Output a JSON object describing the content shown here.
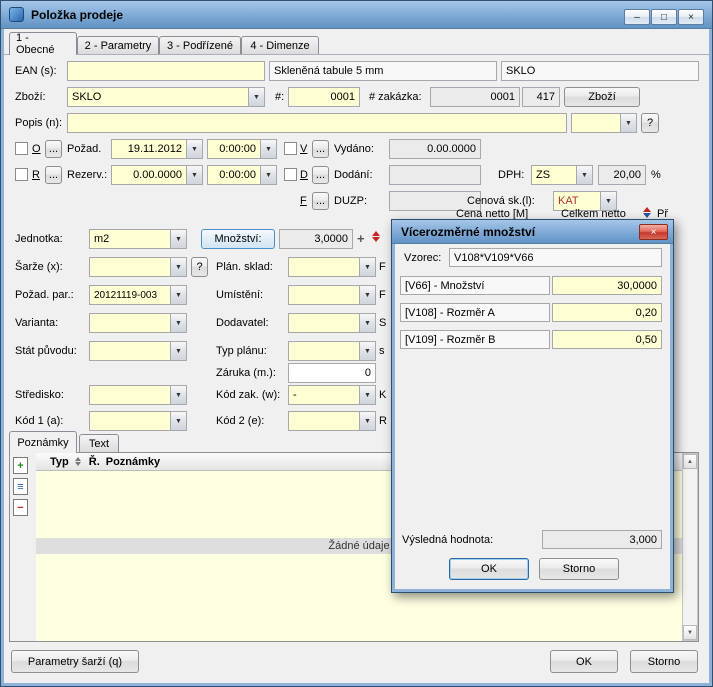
{
  "window": {
    "title": "Položka prodeje",
    "controls": {
      "minimize": "–",
      "maximize": "□",
      "close": "×"
    }
  },
  "tabs": [
    "1 - Obecné",
    "2 - Parametry",
    "3 - Podřízené",
    "4 - Dimenze"
  ],
  "icons": {
    "combo_arrow": "▼",
    "scroll_up": "▲",
    "scroll_down": "▼",
    "plus": "+",
    "add_note": "+",
    "edit_note": "≡",
    "delete_note": "−"
  },
  "form": {
    "ean_label": "EAN (s):",
    "ean_value": "",
    "item_name": "Skleněná tabule 5 mm",
    "item_code": "SKLO",
    "zbozi_label": "Zboží:",
    "zbozi_value": "SKLO",
    "num_label": "#:",
    "num_value": "0001",
    "order_label": "# zakázka:",
    "order_value": "0001",
    "order_id": "417",
    "zbozi_btn": "Zboží",
    "popis_label": "Popis (n):",
    "popis_value": "",
    "popis_combo_value": "",
    "help_btn": "?",
    "dots": "...",
    "o_letter": "O",
    "pozad_label": "Požad.",
    "pozad_date": "19.11.2012",
    "pozad_time": "0:00:00",
    "v_letter": "V",
    "vydano_label": "Vydáno:",
    "vydano_value": "0.00.0000",
    "r_letter": "R",
    "rezerv_label": "Rezerv.:",
    "rezerv_date": "0.00.0000",
    "rezerv_time": "0:00:00",
    "d_letter": "D",
    "dodani_label": "Dodání:",
    "dodani_value": "",
    "dph_label": "DPH:",
    "dph_value": "ZS",
    "dph_rate": "20,00",
    "percent": "%",
    "f_letter": "F",
    "duzp_label": "DUZP:",
    "duzp_value": "",
    "cenova_label": "Cenová sk.(l):",
    "cenova_value": "KAT",
    "cena_netto": "Cena netto [M]",
    "celkem_netto": "Celkem netto",
    "pr_fragment": "Př",
    "jednotka_label": "Jednotka:",
    "jednotka_value": "m2",
    "mnozstvi_btn": "Množství:",
    "mnozstvi_value": "3,0000",
    "sarze_label": "Šarže (x):",
    "sarze_value": "",
    "plan_label": "Plán. sklad:",
    "plan_value": "",
    "pozpar_label": "Požad. par.:",
    "pozpar_value": "20121119-003",
    "umisteni_label": "Umístění:",
    "umisteni_value": "",
    "varianta_label": "Varianta:",
    "varianta_value": "",
    "dodavatel_label": "Dodavatel:",
    "dodavatel_value": "",
    "stat_label": "Stát původu:",
    "stat_value": "",
    "typplanu_label": "Typ plánu:",
    "typplanu_value": "",
    "zaruka_label": "Záruka (m.):",
    "zaruka_value": "0",
    "stredisko_label": "Středisko:",
    "stredisko_value": "",
    "kodzak_label": "Kód zak. (w):",
    "kodzak_value": "-",
    "kod1_label": "Kód 1 (a):",
    "kod1_value": "",
    "kod2_label": "Kód 2 (e):",
    "kod2_value": "",
    "fragments": [
      "F",
      "F",
      "S",
      "s",
      "K",
      "R"
    ]
  },
  "notes": {
    "tabs": [
      "Poznámky",
      "Text"
    ],
    "col_typ": "Typ",
    "col_r": "Ř.",
    "col_poznamky": "Poznámky",
    "empty": "Žádné údaje"
  },
  "footer": {
    "params": "Parametry šarží (q)",
    "ok": "OK",
    "storno": "Storno"
  },
  "modal": {
    "title": "Vícerozměrné množství",
    "close": "×",
    "vzorec_label": "Vzorec:",
    "vzorec_value": "V108*V109*V66",
    "rows": [
      {
        "label": "[V66] - Množství",
        "value": "30,0000"
      },
      {
        "label": "[V108] - Rozměr A",
        "value": "0,20"
      },
      {
        "label": "[V109] - Rozměr B",
        "value": "0,50"
      }
    ],
    "result_label": "Výsledná hodnota:",
    "result_value": "3,000",
    "ok": "OK",
    "storno": "Storno"
  },
  "colors": {
    "title_blue": "#6293c4",
    "input_yellow": "#ffffd4",
    "kat_red": "#b03030",
    "focus_blue": "#2d69a0"
  }
}
